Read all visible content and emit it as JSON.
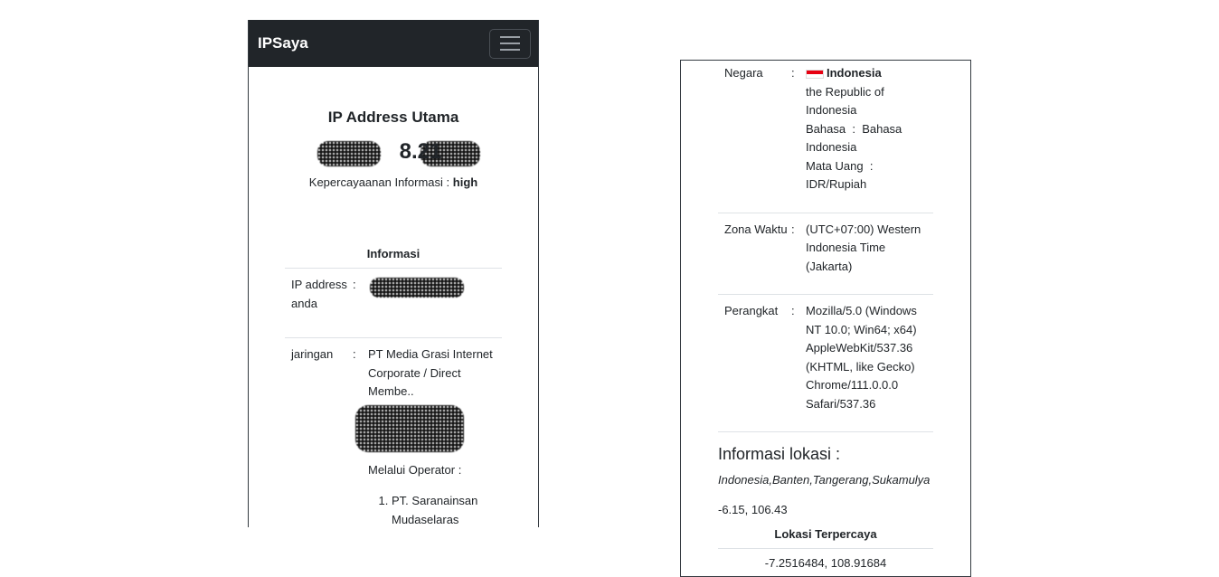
{
  "navbar": {
    "brand": "IPSaya",
    "menu_icon": "hamburger-icon"
  },
  "hero": {
    "title": "IP Address Utama",
    "ip_visible": "8.21",
    "trust_label": "Kepercayaanan Informasi :",
    "trust_value": "high"
  },
  "info": {
    "heading": "Informasi",
    "rows": [
      {
        "key": "IP address anda",
        "sep": ":"
      },
      {
        "key": "jaringan",
        "sep": ":",
        "value": "PT Media Grasi Internet Corporate / Direct Membe.."
      }
    ],
    "operator_label": "Melalui Operator :",
    "operators": [
      "PT. Saranainsan Mudaselaras"
    ]
  },
  "details": {
    "negara": {
      "key": "Negara",
      "sep": ":",
      "country": "Indonesia",
      "official_name": "the Republic of Indonesia",
      "bahasa_label": "Bahasa",
      "bahasa_sep": ":",
      "bahasa_value": "Bahasa Indonesia",
      "currency_label": "Mata Uang",
      "currency_sep": ":",
      "currency_value": "IDR/Rupiah"
    },
    "zona": {
      "key": "Zona Waktu",
      "sep": ":",
      "value": "(UTC+07:00) Western Indonesia Time (Jakarta)"
    },
    "perangkat": {
      "key": "Perangkat",
      "sep": ":",
      "value": "Mozilla/5.0 (Windows NT 10.0; Win64; x64) AppleWebKit/537.36 (KHTML, like Gecko) Chrome/111.0.0.0 Safari/537.36"
    }
  },
  "location": {
    "title": "Informasi lokasi :",
    "path": "Indonesia,Banten,Tangerang,Sukamulya",
    "coords": "-6.15, 106.43",
    "trusted_heading": "Lokasi Terpercaya",
    "trusted_coords": "-7.2516484, 108.91684"
  },
  "colors": {
    "navbar_bg": "#212529",
    "flag_red": "#e70011"
  }
}
